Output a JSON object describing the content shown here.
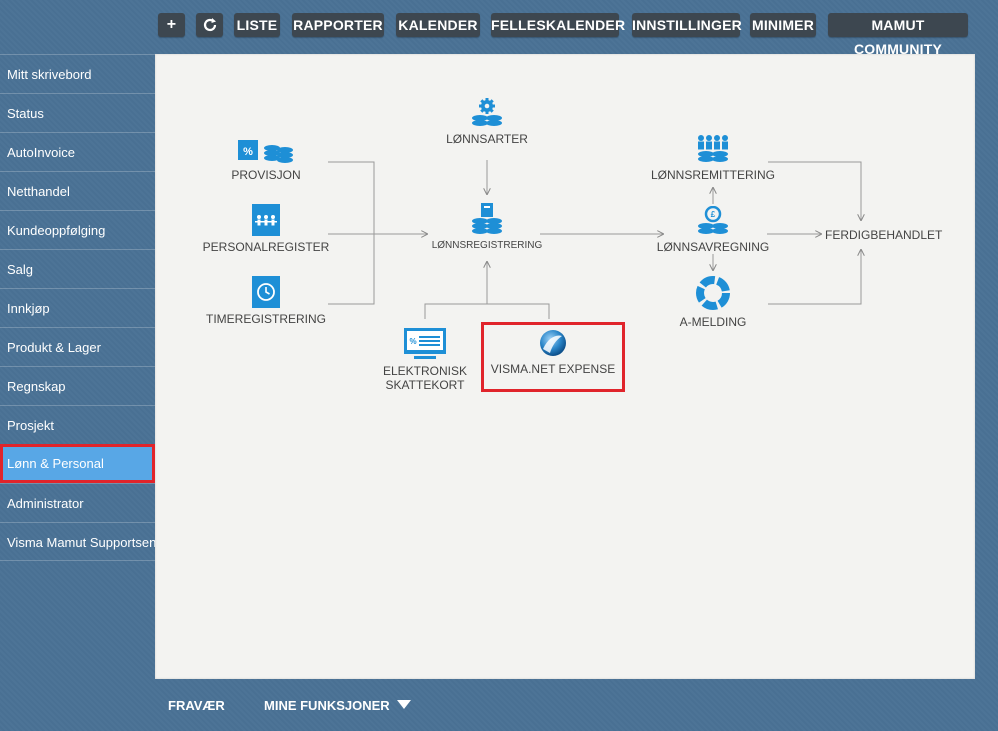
{
  "toolbar": {
    "items": [
      {
        "label": "LISTE"
      },
      {
        "label": "RAPPORTER"
      },
      {
        "label": "KALENDER"
      },
      {
        "label": "FELLESKALENDER"
      },
      {
        "label": "INNSTILLINGER"
      },
      {
        "label": "MINIMER"
      },
      {
        "label": "MAMUT COMMUNITY"
      }
    ],
    "add_icon": "plus-icon",
    "refresh_icon": "refresh-icon"
  },
  "sidebar": {
    "items": [
      {
        "label": "Mitt skrivebord"
      },
      {
        "label": "Status"
      },
      {
        "label": "AutoInvoice"
      },
      {
        "label": "Netthandel"
      },
      {
        "label": "Kundeoppfølging"
      },
      {
        "label": "Salg"
      },
      {
        "label": "Innkjøp"
      },
      {
        "label": "Produkt & Lager"
      },
      {
        "label": "Regnskap"
      },
      {
        "label": "Prosjekt"
      },
      {
        "label": "Lønn & Personal"
      },
      {
        "label": "Administrator"
      },
      {
        "label": "Visma Mamut Supportsenter"
      }
    ],
    "active": "Lønn & Personal"
  },
  "workflow": {
    "provisjon": "PROVISJON",
    "personalregister": "PERSONALREGISTER",
    "timeregistrering": "TIMEREGISTRERING",
    "lonnsarter": "LØNNSARTER",
    "lonnsregistrering": "LØNNSREGISTRERING",
    "elektronisk_line1": "ELEKTRONISK",
    "elektronisk_line2": "SKATTEKORT",
    "visma_expense": "VISMA.NET EXPENSE",
    "lonnsremittering": "LØNNSREMITTERING",
    "lonnsavregning": "LØNNSAVREGNING",
    "amelding": "A-MELDING",
    "ferdigbehandlet": "FERDIGBEHANDLET"
  },
  "bottom": {
    "fravaer": "FRAVÆR",
    "mine_funksjoner": "MINE FUNKSJONER"
  },
  "colors": {
    "background": "#4a7295",
    "accent_blue": "#1e8fd6",
    "active_item": "#58a7e6",
    "highlight_red": "#e0242b",
    "toolbar_button": "#3d4750"
  }
}
